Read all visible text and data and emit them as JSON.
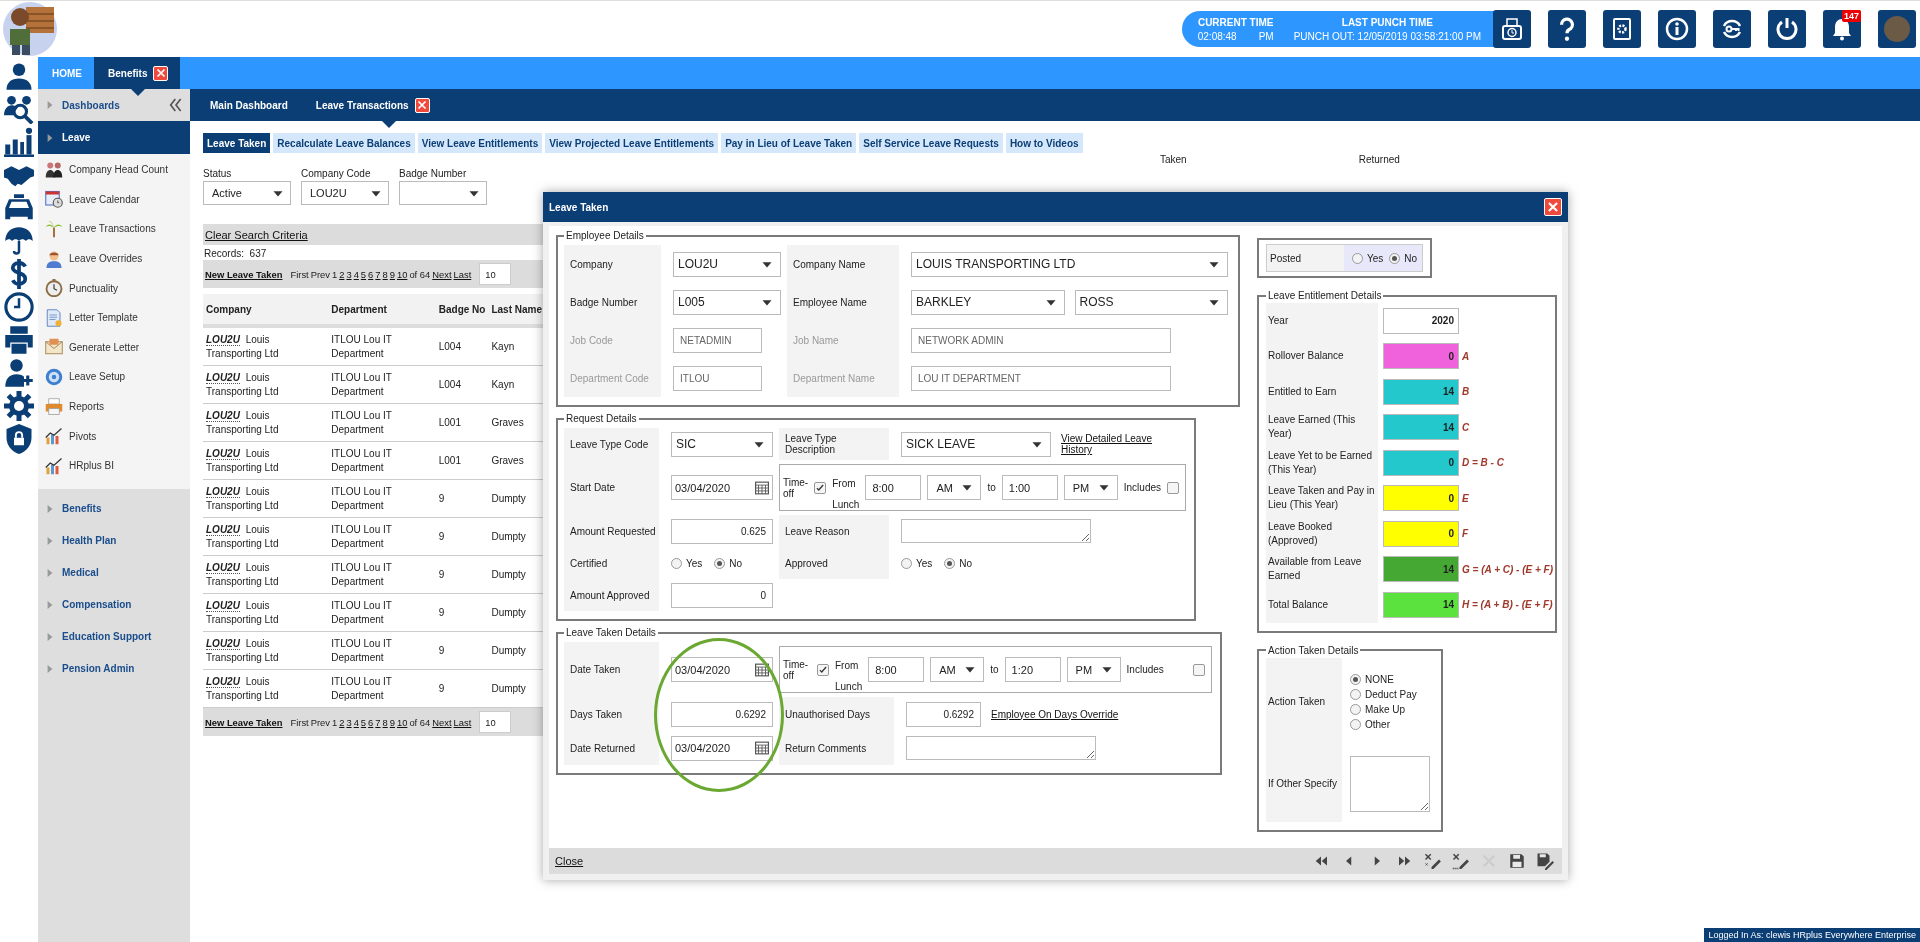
{
  "header": {
    "current_time_label": "CURRENT TIME",
    "current_time": "02:08:48",
    "current_period": "PM",
    "last_punch_label": "LAST PUNCH TIME",
    "last_punch": "PUNCH OUT: 12/05/2019 03:58:21:00 PM",
    "notification_count": "147"
  },
  "top_tabs": [
    {
      "label": "HOME",
      "selected": false,
      "closable": false
    },
    {
      "label": "Benefits",
      "selected": true,
      "closable": true
    }
  ],
  "sidebar": {
    "sections": [
      {
        "label": "Dashboards",
        "expanded": false
      },
      {
        "label": "Leave",
        "expanded": true,
        "items": [
          {
            "label": "Company Head Count"
          },
          {
            "label": "Leave Calendar"
          },
          {
            "label": "Leave Transactions"
          },
          {
            "label": "Leave Overrides"
          },
          {
            "label": "Punctuality"
          },
          {
            "label": "Letter Template"
          },
          {
            "label": "Generate Letter"
          },
          {
            "label": "Leave Setup"
          },
          {
            "label": "Reports"
          },
          {
            "label": "Pivots"
          },
          {
            "label": "HRplus BI"
          }
        ]
      },
      {
        "label": "Benefits",
        "expanded": false
      },
      {
        "label": "Health Plan",
        "expanded": false
      },
      {
        "label": "Medical",
        "expanded": false
      },
      {
        "label": "Compensation",
        "expanded": false
      },
      {
        "label": "Education Support",
        "expanded": false
      },
      {
        "label": "Pension Admin",
        "expanded": false
      }
    ]
  },
  "page_tabs": [
    {
      "label": "Main Dashboard",
      "selected": false,
      "closable": false
    },
    {
      "label": "Leave Transactions",
      "selected": true,
      "closable": true
    }
  ],
  "sub_tabs": [
    {
      "label": "Leave Taken",
      "selected": true
    },
    {
      "label": "Recalculate Leave Balances",
      "selected": false
    },
    {
      "label": "View Leave Entitlements",
      "selected": false
    },
    {
      "label": "View Projected Leave Entitlements",
      "selected": false
    },
    {
      "label": "Pay in Lieu of Leave Taken",
      "selected": false
    },
    {
      "label": "Self Service Leave Requests",
      "selected": false
    },
    {
      "label": "How to Videos",
      "selected": false
    }
  ],
  "filters": [
    {
      "label": "Status",
      "value": "Active"
    },
    {
      "label": "Company Code",
      "value": "LOU2U"
    },
    {
      "label": "Badge Number"
    }
  ],
  "filter_group_labels": [
    "Taken",
    "Returned"
  ],
  "clear_search": "Clear Search Criteria",
  "records": "Records:  637",
  "pagers": [
    {
      "new_link": "New Leave Taken",
      "first": "First",
      "prev": "Prev",
      "current": "1",
      "pages": [
        "2",
        "3",
        "4",
        "5",
        "6",
        "7",
        "8",
        "9",
        "10"
      ],
      "total": "of 64",
      "next": "Next",
      "last": "Last",
      "page_size": "10"
    },
    {
      "new_link": "New Leave Taken",
      "first": "First",
      "prev": "Prev",
      "current": "1",
      "pages": [
        "2",
        "3",
        "4",
        "5",
        "6",
        "7",
        "8",
        "9",
        "10"
      ],
      "total": "of 64",
      "next": "Next",
      "last": "Last",
      "page_size": "10"
    }
  ],
  "table": {
    "columns": [
      "Company",
      "Department",
      "Badge No",
      "Last Name"
    ],
    "rows": [
      {
        "company_code": "LOU2U",
        "company_name": "Louis Transporting Ltd",
        "department_code": "ITLOU",
        "department_name": "Lou IT Department",
        "badge_no": "L004",
        "last_name": "Kayn"
      },
      {
        "company_code": "LOU2U",
        "company_name": "Louis Transporting Ltd",
        "department_code": "ITLOU",
        "department_name": "Lou IT Department",
        "badge_no": "L004",
        "last_name": "Kayn"
      },
      {
        "company_code": "LOU2U",
        "company_name": "Louis Transporting Ltd",
        "department_code": "ITLOU",
        "department_name": "Lou IT Department",
        "badge_no": "L001",
        "last_name": "Graves"
      },
      {
        "company_code": "LOU2U",
        "company_name": "Louis Transporting Ltd",
        "department_code": "ITLOU",
        "department_name": "Lou IT Department",
        "badge_no": "L001",
        "last_name": "Graves"
      },
      {
        "company_code": "LOU2U",
        "company_name": "Louis Transporting Ltd",
        "department_code": "ITLOU",
        "department_name": "Lou IT Department",
        "badge_no": "9",
        "last_name": "Dumpty"
      },
      {
        "company_code": "LOU2U",
        "company_name": "Louis Transporting Ltd",
        "department_code": "ITLOU",
        "department_name": "Lou IT Department",
        "badge_no": "9",
        "last_name": "Dumpty"
      },
      {
        "company_code": "LOU2U",
        "company_name": "Louis Transporting Ltd",
        "department_code": "ITLOU",
        "department_name": "Lou IT Department",
        "badge_no": "9",
        "last_name": "Dumpty"
      },
      {
        "company_code": "LOU2U",
        "company_name": "Louis Transporting Ltd",
        "department_code": "ITLOU",
        "department_name": "Lou IT Department",
        "badge_no": "9",
        "last_name": "Dumpty"
      },
      {
        "company_code": "LOU2U",
        "company_name": "Louis Transporting Ltd",
        "department_code": "ITLOU",
        "department_name": "Lou IT Department",
        "badge_no": "9",
        "last_name": "Dumpty"
      },
      {
        "company_code": "LOU2U",
        "company_name": "Louis Transporting Ltd",
        "department_code": "ITLOU",
        "department_name": "Lou IT Department",
        "badge_no": "9",
        "last_name": "Dumpty"
      }
    ]
  },
  "dialog": {
    "title": "Leave Taken",
    "employee": {
      "legend": "Employee Details",
      "rows": [
        {
          "cells": [
            {
              "label": "Company",
              "disabled": false,
              "inputs": [
                {
                  "kind": "select",
                  "value": "LOU2U"
                }
              ]
            },
            {
              "label": "Company Name",
              "disabled": false,
              "inputs": [
                {
                  "kind": "select",
                  "value": "LOUIS TRANSPORTING LTD"
                }
              ]
            }
          ]
        },
        {
          "cells": [
            {
              "label": "Badge Number",
              "disabled": false,
              "inputs": [
                {
                  "kind": "select",
                  "value": "L005"
                }
              ]
            },
            {
              "label": "Employee Name",
              "disabled": false,
              "inputs": [
                {
                  "kind": "select",
                  "value": "BARKLEY"
                },
                {
                  "kind": "select",
                  "value": "ROSS"
                }
              ]
            }
          ]
        },
        {
          "cells": [
            {
              "label": "Job Code",
              "disabled": true,
              "inputs": [
                {
                  "kind": "text",
                  "value": "NETADMIN"
                }
              ]
            },
            {
              "label": "Job Name",
              "disabled": true,
              "inputs": [
                {
                  "kind": "text",
                  "value": "NETWORK ADMIN"
                }
              ]
            }
          ]
        },
        {
          "cells": [
            {
              "label": "Department Code",
              "disabled": true,
              "inputs": [
                {
                  "kind": "text",
                  "value": "ITLOU"
                }
              ]
            },
            {
              "label": "Department Name",
              "disabled": true,
              "inputs": [
                {
                  "kind": "text",
                  "value": "LOU IT DEPARTMENT"
                }
              ]
            }
          ]
        }
      ]
    },
    "request": {
      "legend": "Request Details",
      "rows": [
        {
          "cells": [
            {
              "label": "Leave Type Code",
              "inputs": [
                {
                  "kind": "select",
                  "value": "SIC"
                }
              ]
            },
            {
              "label": "Leave Type Description",
              "inputs": [
                {
                  "kind": "select",
                  "value": "SICK LEAVE"
                },
                {
                  "kind": "link",
                  "value": "View Detailed Leave History"
                }
              ]
            }
          ]
        },
        {
          "cells": [
            {
              "label": "Start Date",
              "inputs": [
                {
                  "kind": "date",
                  "value": "03/04/2020"
                }
              ]
            },
            {
              "kind": "time_off",
              "time_off_label": "Time-off",
              "time_off": true,
              "from_label": "From",
              "lunch_label": "Lunch",
              "from": "8:00",
              "from_period": "AM",
              "to_label": "to",
              "to": "1:00",
              "to_period": "PM",
              "includes_label": "Includes",
              "includes_lunch": false
            }
          ]
        },
        {
          "cells": [
            {
              "label": "Amount Requested",
              "inputs": [
                {
                  "kind": "number",
                  "value": "0.625"
                }
              ]
            },
            {
              "label": "Leave Reason",
              "inputs": [
                {
                  "kind": "textarea"
                }
              ]
            }
          ]
        },
        {
          "cells": [
            {
              "label": "Certified",
              "inputs": [
                {
                  "kind": "radio",
                  "options": [
                    {
                      "label": "Yes",
                      "selected": false
                    },
                    {
                      "label": "No",
                      "selected": true
                    }
                  ]
                }
              ]
            },
            {
              "label": "Approved",
              "inputs": [
                {
                  "kind": "radio",
                  "options": [
                    {
                      "label": "Yes",
                      "selected": false
                    },
                    {
                      "label": "No",
                      "selected": true
                    }
                  ]
                }
              ]
            }
          ]
        },
        {
          "cells": [
            {
              "label": "Amount Approved",
              "inputs": [
                {
                  "kind": "number",
                  "value": "0"
                }
              ]
            }
          ]
        }
      ]
    },
    "taken": {
      "legend": "Leave Taken Details",
      "rows": [
        {
          "cells": [
            {
              "label": "Date Taken",
              "inputs": [
                {
                  "kind": "date",
                  "value": "03/04/2020"
                }
              ]
            },
            {
              "kind": "time_off",
              "time_off_label": "Time-off",
              "time_off": true,
              "from_label": "From",
              "lunch_label": "Lunch",
              "from": "8:00",
              "from_period": "AM",
              "to_label": "to",
              "to": "1:20",
              "to_period": "PM",
              "includes_label": "Includes",
              "includes_lunch": false
            }
          ]
        },
        {
          "cells": [
            {
              "label": "Days Taken",
              "inputs": [
                {
                  "kind": "number",
                  "value": "0.6292"
                }
              ]
            },
            {
              "label": "Unauthorised Days",
              "inputs": [
                {
                  "kind": "number",
                  "value": "0.6292"
                },
                {
                  "kind": "link",
                  "value": "Employee On Days Override"
                }
              ]
            }
          ]
        },
        {
          "cells": [
            {
              "label": "Date Returned",
              "inputs": [
                {
                  "kind": "date",
                  "value": "03/04/2020"
                }
              ]
            },
            {
              "label": "Return Comments",
              "inputs": [
                {
                  "kind": "textarea"
                }
              ]
            }
          ]
        }
      ]
    },
    "posted": {
      "label": "Posted",
      "options": [
        {
          "label": "Yes",
          "selected": false
        },
        {
          "label": "No",
          "selected": true
        }
      ]
    },
    "entitlement": {
      "legend": "Leave Entitlement Details",
      "year_label": "Year",
      "year": "2020",
      "rows": [
        {
          "label": "Rollover Balance",
          "value": "0",
          "color": "#f062dc",
          "formula": "A"
        },
        {
          "label": "Entitled to Earn",
          "value": "14",
          "color": "#22c8cc",
          "formula": "B"
        },
        {
          "label": "Leave Earned (This Year)",
          "value": "14",
          "color": "#22c8cc",
          "formula": "C"
        },
        {
          "label": "Leave Yet to be Earned (This Year)",
          "value": "0",
          "color": "#22c8cc",
          "formula": "D = B - C"
        },
        {
          "label": "Leave Taken and Pay in Lieu (This Year)",
          "value": "0",
          "color": "#ffff00",
          "formula": "E"
        },
        {
          "label": "Leave Booked (Approved)",
          "value": "0",
          "color": "#ffff00",
          "formula": "F"
        },
        {
          "label": "Available from Leave Earned",
          "value": "14",
          "color": "#45a833",
          "formula": "G = (A + C) - (E + F)"
        },
        {
          "label": "Total Balance",
          "value": "14",
          "color": "#5be23e",
          "formula": "H = (A + B) - (E + F)"
        }
      ]
    },
    "action": {
      "legend": "Action Taken Details",
      "label": "Action Taken",
      "options": [
        {
          "label": "NONE",
          "selected": true
        },
        {
          "label": "Deduct Pay",
          "selected": false
        },
        {
          "label": "Make Up",
          "selected": false
        },
        {
          "label": "Other",
          "selected": false
        }
      ],
      "other_label": "If Other Specify"
    },
    "close_link": "Close"
  },
  "status_bar": {
    "text": "Logged In As: clewis HRplus Everywhere Enterprise"
  }
}
